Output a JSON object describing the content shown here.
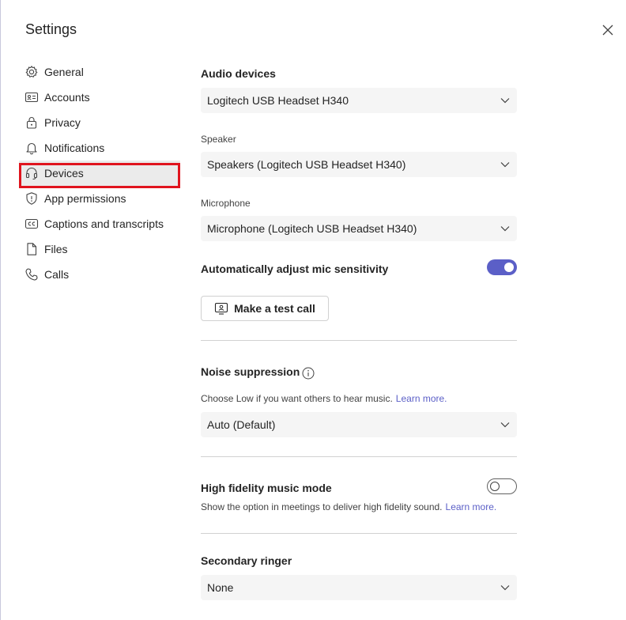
{
  "header": {
    "title": "Settings"
  },
  "sidebar": {
    "items": [
      {
        "label": "General",
        "icon": "gear-icon"
      },
      {
        "label": "Accounts",
        "icon": "id-card-icon"
      },
      {
        "label": "Privacy",
        "icon": "lock-icon"
      },
      {
        "label": "Notifications",
        "icon": "bell-icon"
      },
      {
        "label": "Devices",
        "icon": "headset-icon",
        "selected": true
      },
      {
        "label": "App permissions",
        "icon": "shield-icon"
      },
      {
        "label": "Captions and transcripts",
        "icon": "cc-icon"
      },
      {
        "label": "Files",
        "icon": "file-icon"
      },
      {
        "label": "Calls",
        "icon": "phone-icon"
      }
    ]
  },
  "audio": {
    "title": "Audio devices",
    "device": "Logitech USB Headset H340",
    "speaker_label": "Speaker",
    "speaker": "Speakers (Logitech USB Headset H340)",
    "microphone_label": "Microphone",
    "microphone": "Microphone (Logitech USB Headset H340)",
    "auto_adjust_label": "Automatically adjust mic sensitivity",
    "auto_adjust_on": true,
    "test_call_label": "Make a test call"
  },
  "noise": {
    "title": "Noise suppression",
    "description": "Choose Low if you want others to hear music.",
    "link": "Learn more.",
    "value": "Auto (Default)"
  },
  "hifi": {
    "title": "High fidelity music mode",
    "description": "Show the option in meetings to deliver high fidelity sound.",
    "link": "Learn more.",
    "on": false
  },
  "ringer": {
    "title": "Secondary ringer",
    "value": "None"
  },
  "colors": {
    "accent": "#5b5fc7",
    "highlight": "#e0141e",
    "dropdown_bg": "#f5f5f5"
  }
}
